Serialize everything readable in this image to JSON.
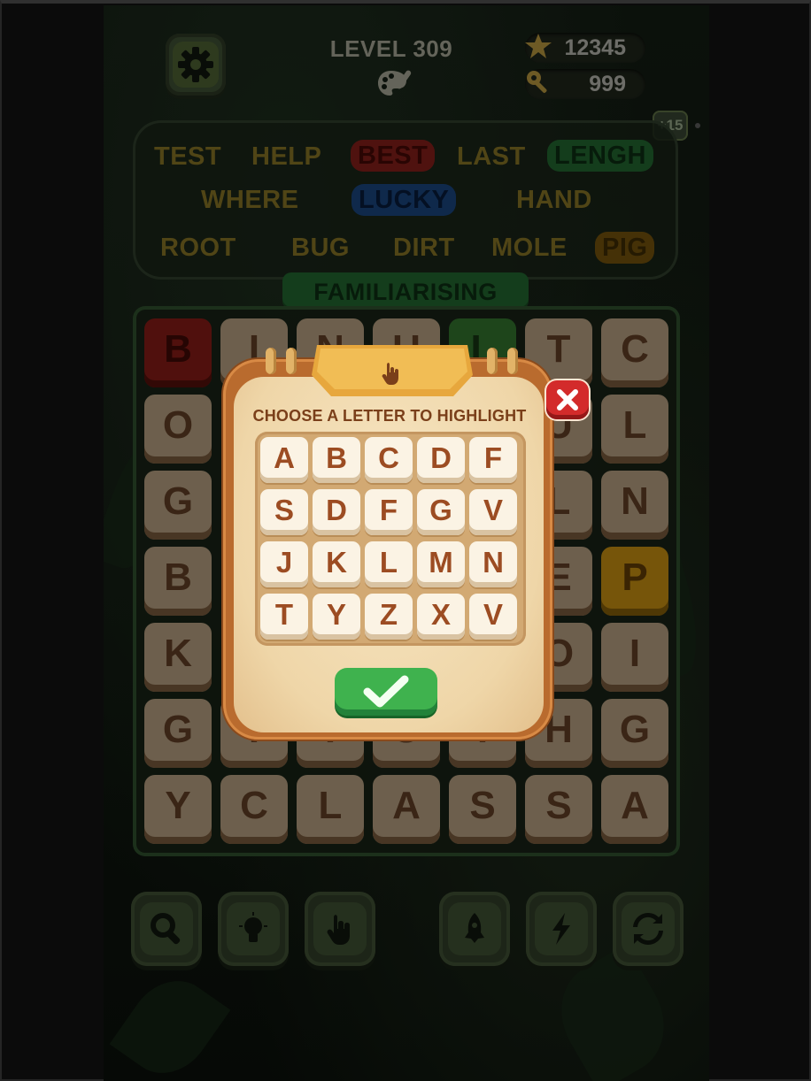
{
  "header": {
    "level_label": "LEVEL 309",
    "stars": "12345",
    "keys": "999",
    "bonus_badge": "+15"
  },
  "words": {
    "row1": [
      "TEST",
      "HELP",
      "BEST",
      "LAST",
      "LENGH"
    ],
    "row2": [
      "WHERE",
      "LUCKY",
      "HAND"
    ],
    "row3": [
      "ROOT",
      "BUG",
      "DIRT",
      "MOLE",
      "PIG"
    ],
    "highlight_colors": {
      "BEST": "#7a1d18",
      "LENGH": "#1f5e2b",
      "LUCKY": "#173f74",
      "PIG": "#6b4c0c"
    }
  },
  "current_word": "FAMILIARISING",
  "grid": {
    "rows": [
      [
        "B",
        "I",
        "N",
        "U",
        "L",
        "T",
        "C"
      ],
      [
        "O",
        "",
        "",
        "",
        "",
        "U",
        "L"
      ],
      [
        "G",
        "",
        "",
        "",
        "",
        "L",
        "N"
      ],
      [
        "B",
        "",
        "",
        "",
        "",
        "E",
        "P"
      ],
      [
        "K",
        "",
        "",
        "",
        "",
        "O",
        "I"
      ],
      [
        "G",
        "I",
        "I",
        "U",
        "I",
        "H",
        "G"
      ],
      [
        "Y",
        "C",
        "L",
        "A",
        "S",
        "S",
        "A"
      ]
    ],
    "tile_colors": {
      "0-0": "red",
      "0-4": "green",
      "3-6": "yellow"
    }
  },
  "modal": {
    "title": "CHOOSE A LETTER TO HIGHLIGHT",
    "letters": [
      [
        "A",
        "B",
        "C",
        "D",
        "F"
      ],
      [
        "S",
        "D",
        "F",
        "G",
        "V"
      ],
      [
        "J",
        "K",
        "L",
        "M",
        "N"
      ],
      [
        "T",
        "Y",
        "Z",
        "X",
        "V"
      ]
    ]
  },
  "toolbar": {
    "icons": [
      "search-icon",
      "lightbulb-icon",
      "hand-pointer-icon",
      "rocket-icon",
      "lightning-icon",
      "refresh-icon"
    ]
  },
  "colors": {
    "background": "#121b12",
    "modal": "#b96b2e",
    "confirm": "#3fb24e",
    "close": "#d32b2b"
  }
}
